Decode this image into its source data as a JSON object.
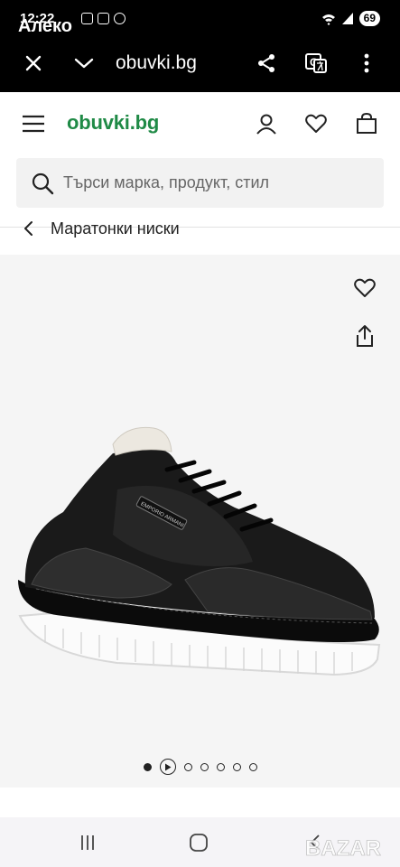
{
  "status_bar": {
    "time": "12:22",
    "overlay_name": "Алеко",
    "battery": "69"
  },
  "browser": {
    "url": "obuvki.bg"
  },
  "site": {
    "logo_main": "obuvki",
    "logo_tld": ".bg",
    "search_placeholder": "Търси марка, продукт, стил"
  },
  "breadcrumb": {
    "label": "Маратонки ниски"
  },
  "gallery": {
    "dot_count": 7,
    "active_index": 0,
    "brand_text": "EMPORIO ARMANI"
  },
  "watermark": {
    "text": "BAZAR"
  },
  "colors": {
    "brand_green": "#1f8a46",
    "topbar": "#000000"
  }
}
